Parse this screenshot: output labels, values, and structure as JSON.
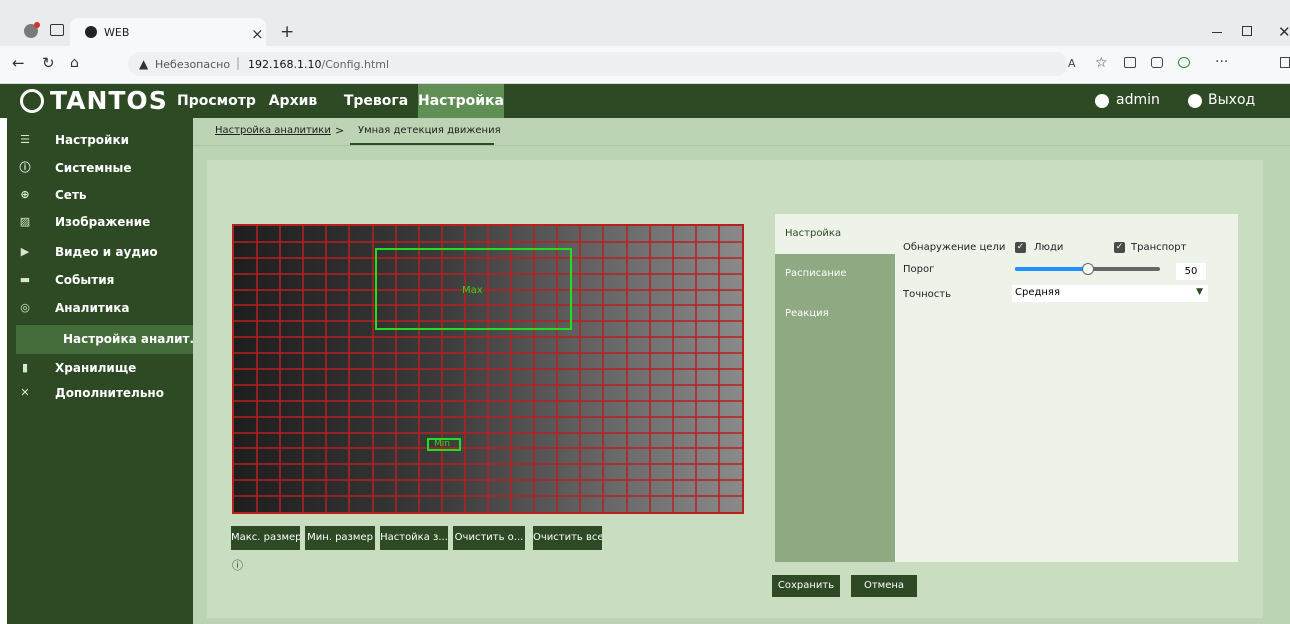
{
  "browser": {
    "tab_title": "WEB",
    "security_label": "Небезопасно",
    "url_host": "192.168.1.10",
    "url_path": "/Config.html",
    "tab_close": "×",
    "new_tab": "+"
  },
  "header": {
    "brand": "TANTOS",
    "nav": [
      "Просмотр",
      "Архив",
      "Тревога",
      "Настройка"
    ],
    "active_nav": "Настройка",
    "user": "admin",
    "logout": "Выход"
  },
  "sidebar": {
    "items": [
      {
        "label": "Настройки",
        "icon": "menu-icon"
      },
      {
        "label": "Системные",
        "icon": "info-icon"
      },
      {
        "label": "Сеть",
        "icon": "globe-icon"
      },
      {
        "label": "Изображение",
        "icon": "image-icon"
      },
      {
        "label": "Видео и аудио",
        "icon": "video-icon"
      },
      {
        "label": "События",
        "icon": "events-icon"
      },
      {
        "label": "Аналитика",
        "icon": "analytics-icon"
      }
    ],
    "active_sub": "Настройка аналит...",
    "bottom_items": [
      {
        "label": "Хранилище",
        "icon": "storage-icon"
      },
      {
        "label": "Дополнительно",
        "icon": "tools-icon"
      }
    ]
  },
  "breadcrumb": {
    "parent": "Настройка аналитики",
    "separator": ">",
    "current": "Умная детекция движения"
  },
  "grid_overlay": {
    "max_label": "Max",
    "min_label": "Min"
  },
  "grid_buttons": [
    "Макс. размер",
    "Мин. размер",
    "Настойка з...",
    "Очистить о...",
    "Очистить все"
  ],
  "info_icon": "ⓘ",
  "settings": {
    "tabs": [
      "Настройка",
      "Расписание",
      "Реакция"
    ],
    "active_tab": "Настройка",
    "detection_label": "Обнаружение цели",
    "people_label": "Люди",
    "transport_label": "Транспорт",
    "threshold_label": "Порог",
    "threshold_value": "50",
    "threshold_fraction": 0.5,
    "accuracy_label": "Точность",
    "accuracy_value": "Средняя"
  },
  "actions": {
    "save": "Сохранить",
    "cancel": "Отмена"
  },
  "colors": {
    "brand_dark": "#2d4a25",
    "accent": "#5f8f55",
    "grid_border": "#b82020",
    "zone": "#22dd22",
    "slider": "#1e90ff"
  }
}
